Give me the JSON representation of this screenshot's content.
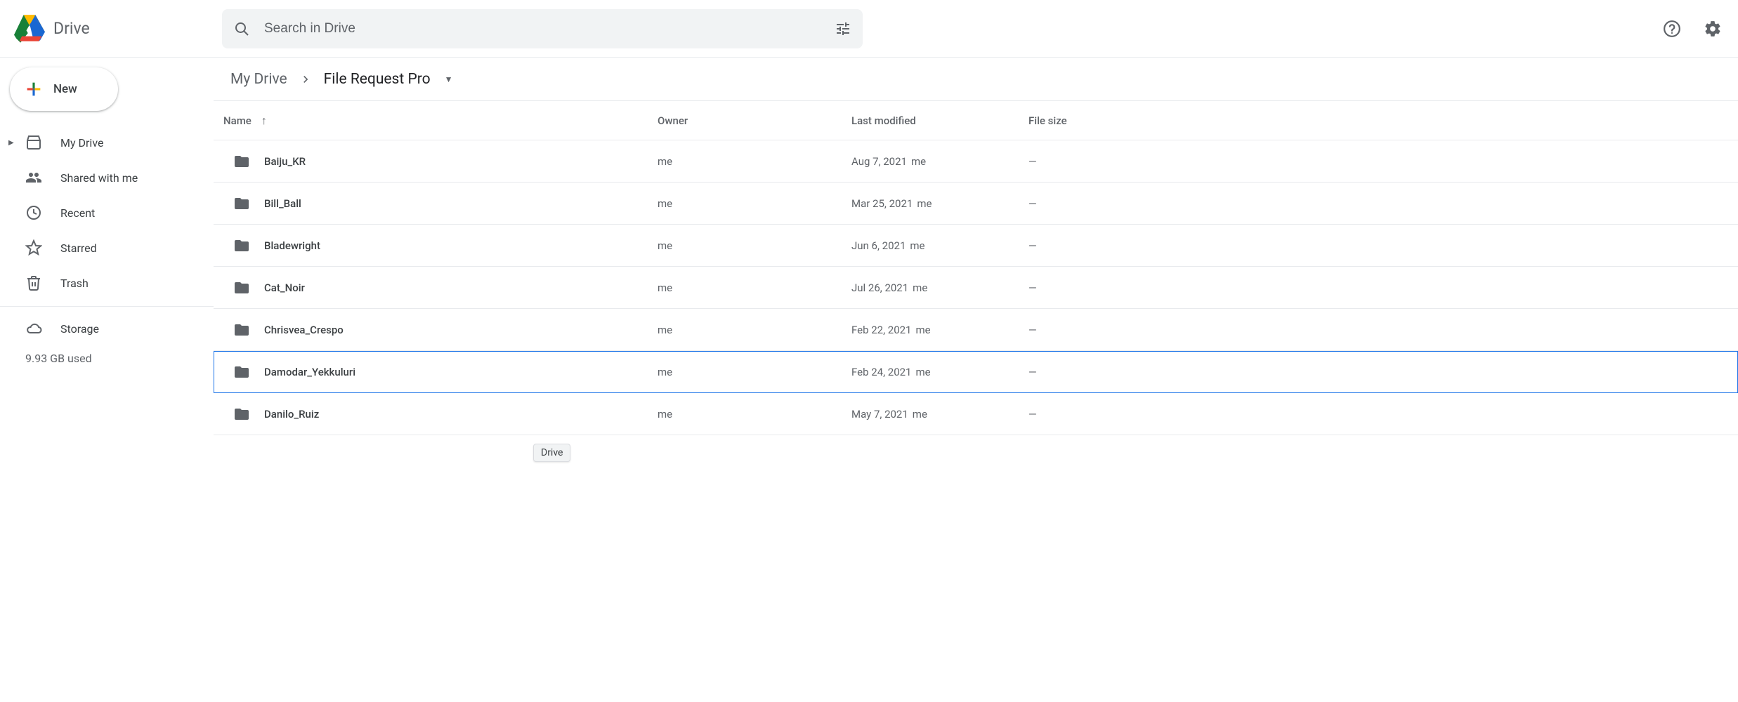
{
  "header": {
    "product_name": "Drive",
    "search_placeholder": "Search in Drive"
  },
  "sidebar": {
    "new_label": "New",
    "items": [
      {
        "label": "My Drive"
      },
      {
        "label": "Shared with me"
      },
      {
        "label": "Recent"
      },
      {
        "label": "Starred"
      },
      {
        "label": "Trash"
      }
    ],
    "storage_label": "Storage",
    "storage_used": "9.93 GB used"
  },
  "breadcrumb": {
    "root": "My Drive",
    "current": "File Request Pro"
  },
  "table": {
    "columns": {
      "name": "Name",
      "owner": "Owner",
      "modified": "Last modified",
      "size": "File size"
    },
    "rows": [
      {
        "name": "Baiju_KR",
        "owner": "me",
        "modified": "Aug 7, 2021",
        "modified_by": "me",
        "size": "—",
        "selected": false
      },
      {
        "name": "Bill_Ball",
        "owner": "me",
        "modified": "Mar 25, 2021",
        "modified_by": "me",
        "size": "—",
        "selected": false
      },
      {
        "name": "Bladewright",
        "owner": "me",
        "modified": "Jun 6, 2021",
        "modified_by": "me",
        "size": "—",
        "selected": false
      },
      {
        "name": "Cat_Noir",
        "owner": "me",
        "modified": "Jul 26, 2021",
        "modified_by": "me",
        "size": "—",
        "selected": false
      },
      {
        "name": "Chrisvea_Crespo",
        "owner": "me",
        "modified": "Feb 22, 2021",
        "modified_by": "me",
        "size": "—",
        "selected": false
      },
      {
        "name": "Damodar_Yekkuluri",
        "owner": "me",
        "modified": "Feb 24, 2021",
        "modified_by": "me",
        "size": "—",
        "selected": true
      },
      {
        "name": "Danilo_Ruiz",
        "owner": "me",
        "modified": "May 7, 2021",
        "modified_by": "me",
        "size": "—",
        "selected": false
      }
    ]
  },
  "tooltip": "Drive"
}
